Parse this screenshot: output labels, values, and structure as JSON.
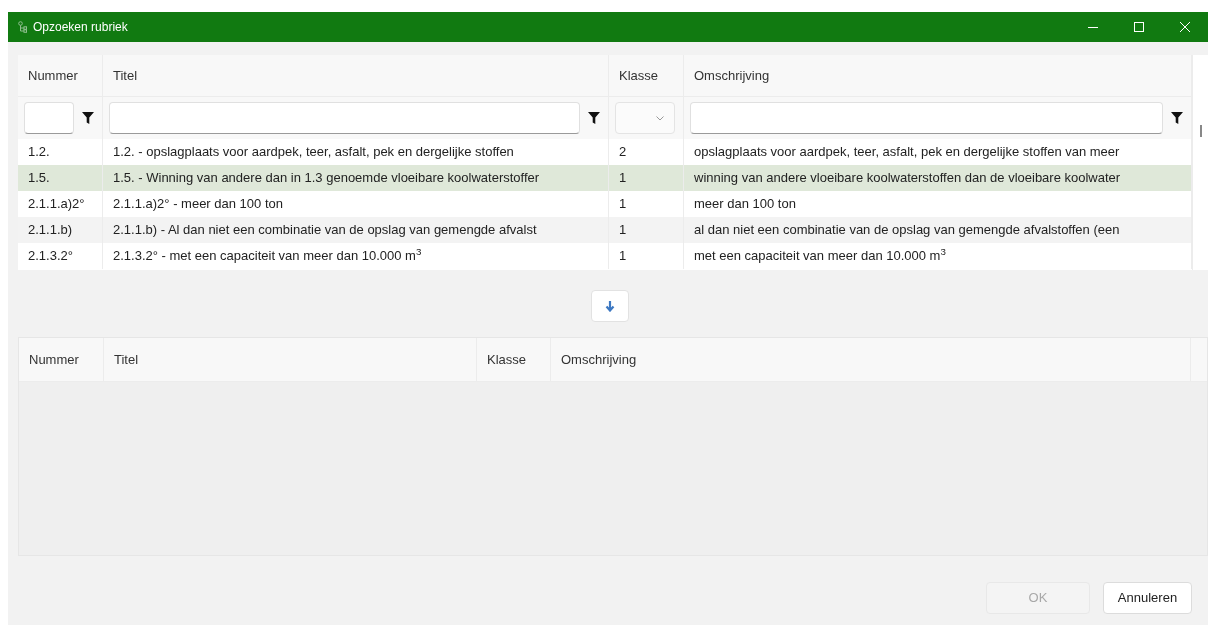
{
  "window": {
    "title": "Opzoeken rubriek"
  },
  "top_table": {
    "columns": [
      "Nummer",
      "Titel",
      "Klasse",
      "Omschrijving"
    ],
    "filters": [
      {
        "kind": "text"
      },
      {
        "kind": "text"
      },
      {
        "kind": "dropdown"
      },
      {
        "kind": "text"
      }
    ],
    "rows": [
      {
        "cells": [
          "1.2.",
          "1.2. - opslagplaats voor aardpek, teer, asfalt, pek en dergelijke stoffen",
          "2",
          "opslagplaats voor aardpek, teer, asfalt, pek en dergelijke stoffen van meer"
        ],
        "selected": false
      },
      {
        "cells": [
          "1.5.",
          "1.5. - Winning van andere dan in 1.3 genoemde vloeibare koolwaterstoffer",
          "1",
          "winning van andere vloeibare koolwaterstoffen dan de vloeibare koolwater"
        ],
        "selected": true
      },
      {
        "cells": [
          "2.1.1.a)2°",
          "2.1.1.a)2° - meer dan 100 ton",
          "1",
          "meer dan 100 ton"
        ],
        "selected": false
      },
      {
        "cells": [
          "2.1.1.b)",
          "2.1.1.b) - Al dan niet een combinatie van de opslag van gemengde afvalst",
          "1",
          "al dan niet een combinatie van de opslag van gemengde afvalstoffen (een"
        ],
        "selected": false
      },
      {
        "cells": [
          "2.1.3.2°",
          "2.1.3.2° - met een capaciteit van meer dan 10.000 m$^{3}$",
          "1",
          "met een capaciteit van meer dan 10.000 m$^{3}$"
        ],
        "selected": false
      }
    ]
  },
  "bottom_table": {
    "columns": [
      "Nummer",
      "Titel",
      "Klasse",
      "Omschrijving"
    ]
  },
  "buttons": [
    {
      "label": "OK",
      "disabled": true
    },
    {
      "label": "Annuleren",
      "disabled": false
    }
  ]
}
